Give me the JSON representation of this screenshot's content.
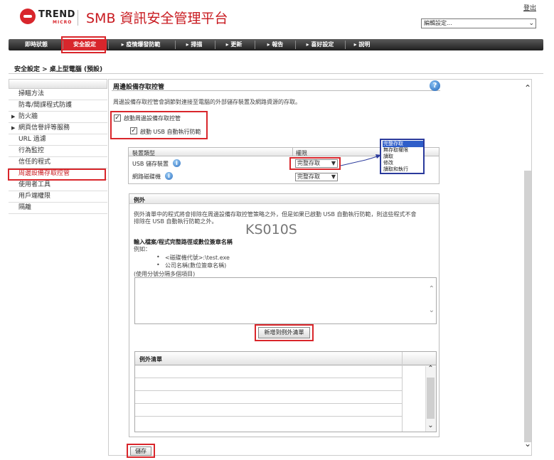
{
  "header": {
    "logo_text": "TREND",
    "logo_sub": "MICRO",
    "app_title": "SMB 資訊安全管理平台",
    "logout": "登出",
    "settings_select": "編輯設定..."
  },
  "nav": {
    "items": [
      "即時狀態",
      "安全設定",
      "▸ 疫情爆發防範",
      "▸ 掃描",
      "▸ 更新",
      "▸ 報告",
      "▸ 喜好設定",
      "▸ 說明"
    ],
    "active_index": 1,
    "active_color": "#d8262c"
  },
  "breadcrumb": "安全設定 > 桌上型電腦 (預設)",
  "sidebar": {
    "items": [
      {
        "label": "掃瞄方法",
        "expand": false
      },
      {
        "label": "防毒/間諜程式防護",
        "expand": false
      },
      {
        "label": "防火牆",
        "expand": true
      },
      {
        "label": "網頁信譽評等服務",
        "expand": true
      },
      {
        "label": "URL 過濾",
        "expand": false
      },
      {
        "label": "行為監控",
        "expand": false
      },
      {
        "label": "信任的程式",
        "expand": false
      },
      {
        "label": "周邊設備存取控管",
        "expand": false,
        "active": true
      },
      {
        "label": "使用者工具",
        "expand": false
      },
      {
        "label": "用戶端權限",
        "expand": false
      },
      {
        "label": "隔離",
        "expand": false
      }
    ],
    "active_color": "#c8191f"
  },
  "panel": {
    "title": "周邊設備存取控管",
    "help_icon": "?",
    "description": "周邊設備存取控管會調節對連接至電腦的外部儲存裝置及網路資源的存取。",
    "enable_label": "啟動周邊設備存取控管",
    "enable_checked": true,
    "usb_autorun_label": "啟動 USB 自動執行防範",
    "usb_autorun_checked": true
  },
  "device_table": {
    "col_device": "裝置類型",
    "col_permission": "權限",
    "rows": [
      {
        "device": "USB 儲存裝置",
        "permission": "完整存取"
      },
      {
        "device": "網路磁碟機",
        "permission": "完整存取"
      }
    ],
    "dropdown_options": [
      "完整存取",
      "無存取權限",
      "讀取",
      "修改",
      "讀取和執行"
    ],
    "dropdown_selected_index": 0
  },
  "exceptions": {
    "title": "例外",
    "desc_line1": "例外清單中的程式將會排除在周邊設備存取控管策略之外，但是如果已啟動 USB 自動執行防範，則這些程式不會",
    "desc_line2": "排除在 USB 自動執行防範之外。",
    "watermark": "KS010S",
    "input_title": "輸入檔案/程式完整路徑或數位簽章名稱",
    "example_label": "例如：",
    "examples": [
      "<磁碟機代號>:\\test.exe",
      "公司名稱(數位簽章名稱)"
    ],
    "separator_note": "(使用分號分隔多個項目)",
    "textarea_value": "",
    "add_button": "新增到例外清單",
    "list_title": "例外清單"
  },
  "save_button": "儲存"
}
